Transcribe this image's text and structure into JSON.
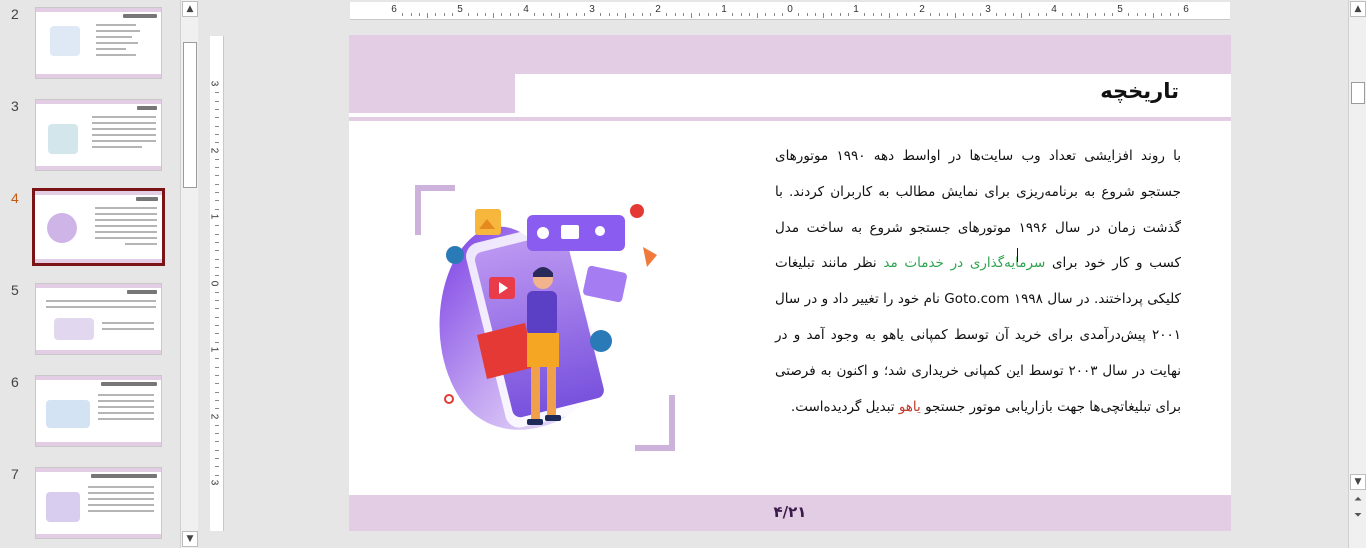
{
  "thumbnails": [
    {
      "number": "2",
      "active": false
    },
    {
      "number": "3",
      "active": false
    },
    {
      "number": "4",
      "active": true
    },
    {
      "number": "5",
      "active": false
    },
    {
      "number": "6",
      "active": false
    },
    {
      "number": "7",
      "active": false
    }
  ],
  "rulers": {
    "horizontal": [
      "6",
      "5",
      "4",
      "3",
      "2",
      "1",
      "0",
      "1",
      "2",
      "3",
      "4",
      "5",
      "6"
    ],
    "vertical": [
      "3",
      "2",
      "1",
      "0",
      "1",
      "2",
      "3"
    ]
  },
  "slide": {
    "title": "تاریخچه",
    "body": {
      "part1": "با روند افزایشی تعداد وب سایت‌ها در اواسط دهه ۱۹۹۰ موتورهای جستجو شروع به برنامه‌ریزی برای نمایش مطالب به کاربران کردند. با گذشت زمان در سال ۱۹۹۶ موتورهای جستجو شروع به ساخت مدل کسب و کار خود برای ",
      "green": "سرمایه‌گذاری در خدمات مد",
      "part2": " نظر مانند تبلیغات کلیکی پرداختند. در سال ۱۹۹۸ Goto.com نام خود را تغییر داد و در سال ۲۰۰۱ پیش‌درآمدی برای خرید آن توسط کمپانی یاهو به وجود آمد و در نهایت در سال ۲۰۰۳ توسط این کمپانی خریداری شد؛ و اکنون به فرصتی برای تبلیغاتچی‌ها جهت بازاریابی موتور جستجو ",
      "red": "یاهو",
      "part3": " تبدیل گردیده‌است."
    },
    "page_number": "۴/۲۱"
  },
  "colors": {
    "band": "#e3cde4",
    "active_thumb_border": "#7b1417",
    "active_thumb_number": "#c55a11",
    "highlight_green": "#2ea44f",
    "highlight_red": "#c0392b"
  },
  "icons": {
    "scroll_up": "triangle-up-icon",
    "scroll_down": "triangle-down-icon",
    "prev_slide": "double-up-icon",
    "next_slide": "double-down-icon"
  }
}
